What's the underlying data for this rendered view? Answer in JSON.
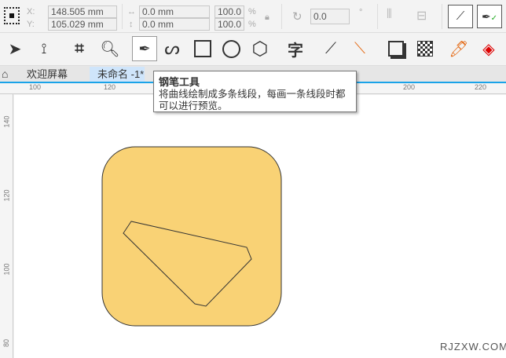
{
  "propertybar": {
    "x_label": "X:",
    "y_label": "Y:",
    "x": "148.505 mm",
    "y": "105.029 mm",
    "w": "0.0 mm",
    "h": "0.0 mm",
    "scale_x": "100.0",
    "scale_y": "100.0",
    "pct": "%",
    "rotation": "0.0",
    "degree": "°"
  },
  "tabs": [
    {
      "label": "欢迎屏幕"
    },
    {
      "label": "未命名 -1*"
    }
  ],
  "tooltip": {
    "title": "钢笔工具",
    "body": "将曲线绘制成多条线段，每画一条线段时都可以进行预览。"
  },
  "ruler": {
    "h": [
      "100",
      "120",
      "200",
      "220"
    ],
    "v": [
      "140",
      "120",
      "100",
      "80"
    ]
  },
  "canvas": {
    "fill": "#f9d275"
  },
  "watermark": "RJZXW.COM"
}
